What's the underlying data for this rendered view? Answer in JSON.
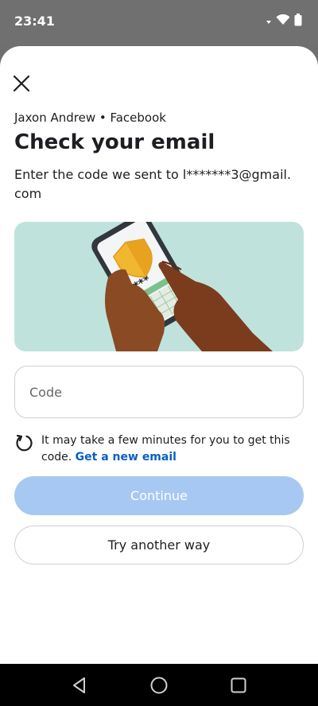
{
  "status_bar": {
    "time": "23:41"
  },
  "header": {
    "account_line": "Jaxon Andrew • Facebook",
    "title": "Check your email",
    "subtitle": "Enter the code we sent to l*******3@gmail.com"
  },
  "code_field": {
    "placeholder": "Code",
    "value": ""
  },
  "info": {
    "text": "It may take a few minutes for you to get this code. ",
    "link": "Get a new email"
  },
  "buttons": {
    "continue": "Continue",
    "try_another": "Try another way"
  },
  "illustration": {
    "masked_code": "****"
  },
  "colors": {
    "primary_disabled": "#a7c8f2",
    "link": "#0a5fc2",
    "illustration_bg": "#bfe3dc"
  }
}
